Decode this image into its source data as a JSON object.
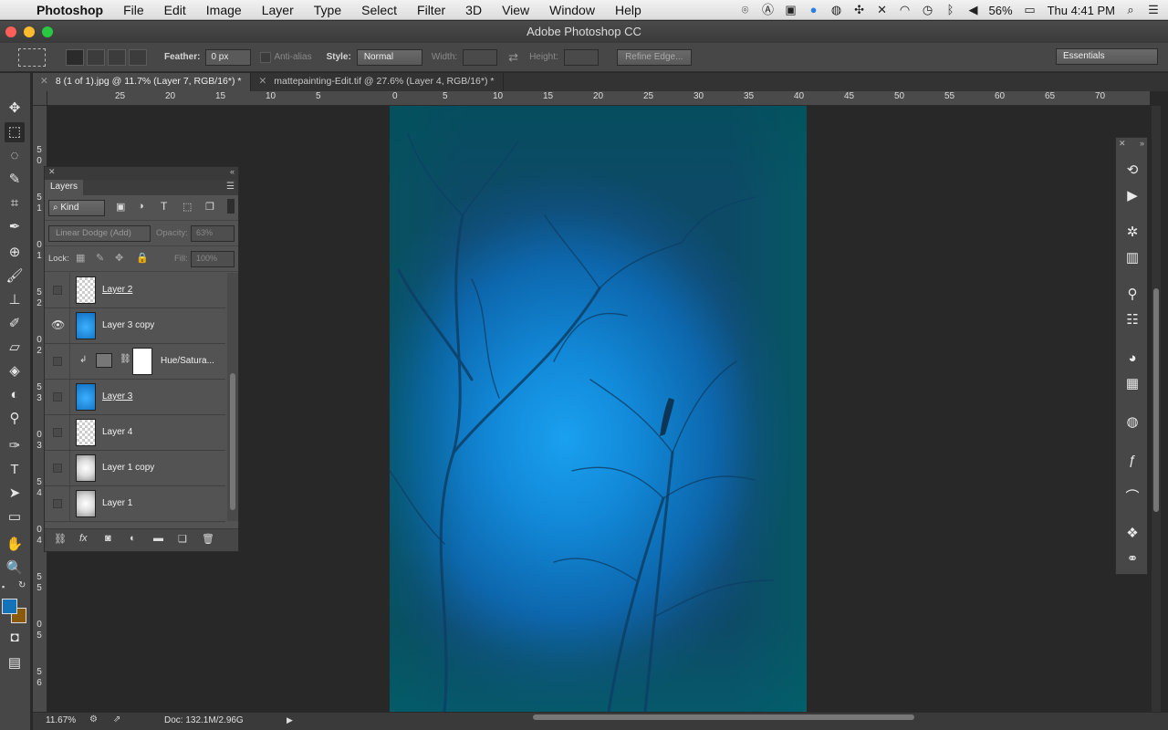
{
  "menubar": {
    "app": "Photoshop",
    "items": [
      "File",
      "Edit",
      "Image",
      "Layer",
      "Type",
      "Select",
      "Filter",
      "3D",
      "View",
      "Window",
      "Help"
    ],
    "battery": "56%",
    "clock": "Thu 4:41 PM"
  },
  "window": {
    "title": "Adobe Photoshop CC"
  },
  "options": {
    "feather_label": "Feather:",
    "feather_value": "0 px",
    "antialias_label": "Anti-alias",
    "style_label": "Style:",
    "style_value": "Normal",
    "width_label": "Width:",
    "height_label": "Height:",
    "refine_label": "Refine Edge...",
    "workspace": "Essentials"
  },
  "tabs": [
    {
      "label": "8 (1 of 1).jpg @ 11.7% (Layer 7, RGB/16*) *"
    },
    {
      "label": "mattepainting-Edit.tif @ 27.6% (Layer 4, RGB/16*) *"
    }
  ],
  "ruler": {
    "h": [
      "25",
      "20",
      "15",
      "10",
      "5",
      "0",
      "5",
      "10",
      "15",
      "20",
      "25",
      "30",
      "35",
      "40",
      "45",
      "50",
      "55",
      "60",
      "65",
      "70"
    ],
    "v": [
      "5",
      "0",
      "5",
      "1",
      "0",
      "1",
      "5",
      "2",
      "0",
      "2",
      "5",
      "3",
      "0",
      "3",
      "5",
      "4",
      "0",
      "4",
      "5",
      "5",
      "0",
      "5",
      "5",
      "6"
    ]
  },
  "layers_panel": {
    "title": "Layers",
    "kind": "Kind",
    "blend_mode": "Linear Dodge (Add)",
    "opacity_label": "Opacity:",
    "opacity_value": "63%",
    "lock_label": "Lock:",
    "fill_label": "Fill:",
    "fill_value": "100%",
    "layers": [
      {
        "name": "Layer 2",
        "visible": false,
        "thumb": "checker"
      },
      {
        "name": "Layer 3 copy",
        "visible": true,
        "thumb": "blue"
      },
      {
        "name": "Hue/Satura...",
        "visible": false,
        "thumb": "adjustment"
      },
      {
        "name": "Layer 3",
        "visible": false,
        "thumb": "blue"
      },
      {
        "name": "Layer 4",
        "visible": false,
        "thumb": "checker"
      },
      {
        "name": "Layer 1 copy",
        "visible": false,
        "thumb": "noise"
      },
      {
        "name": "Layer 1",
        "visible": false,
        "thumb": "noise"
      }
    ]
  },
  "status": {
    "zoom": "11.67%",
    "doc": "Doc: 132.1M/2.96G"
  },
  "colors": {
    "foreground": "#1472b8",
    "background": "#8a5a0a"
  }
}
